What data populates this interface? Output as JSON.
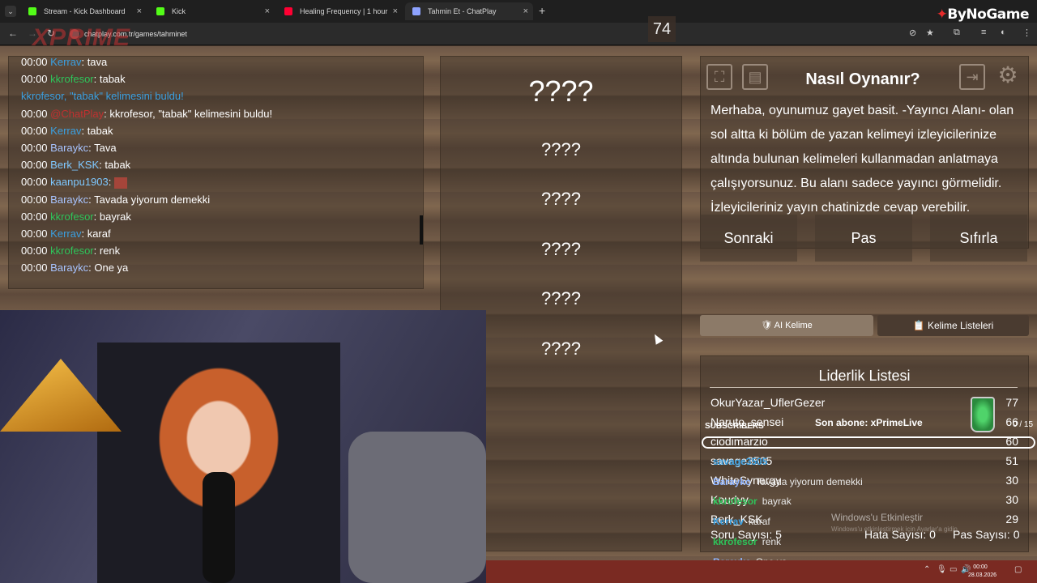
{
  "browser": {
    "tabs": [
      {
        "label": "Stream - Kick Dashboard",
        "icon_color": "#53fc18"
      },
      {
        "label": "Kick",
        "icon_color": "#53fc18"
      },
      {
        "label": "Healing Frequency | 1 hour",
        "icon_color": "#ff0033"
      },
      {
        "label": "Tahmin Et - ChatPlay",
        "icon_color": "#8ea3ff"
      }
    ],
    "url": "chatplay.com.tr/games/tahminet",
    "brand_prefix": "ByNo",
    "brand_suffix": "Game"
  },
  "overlay": {
    "xprime_logo": "XPRIME",
    "subscribers_label": "SUBSCRIBERS",
    "last_sub": "Son abone: xPrimeLive",
    "sub_progress": "0 / 15",
    "windows_watermark": "Windows'u Etkinleştir",
    "windows_watermark_sub": "Windows'u etkinleştirmek için Ayarlar'a gidin.",
    "clock_time": "00:00",
    "clock_date": "28.03.2026",
    "chat": [
      {
        "user": "savage3505",
        "msg": "",
        "color": "#3a9fe0"
      },
      {
        "user": "Baraykc",
        "msg": "Tavada yiyorum demekki",
        "color": "#8fb4ff"
      },
      {
        "user": "kkrofesor",
        "msg": "bayrak",
        "color": "#2ec45a"
      },
      {
        "user": "Kerrav",
        "msg": "karaf",
        "color": "#3a9fe0"
      },
      {
        "user": "kkrofesor",
        "msg": "renk",
        "color": "#2ec45a"
      },
      {
        "user": "Baraykc",
        "msg": "One ya",
        "color": "#8fb4ff"
      }
    ]
  },
  "chat": {
    "lines": [
      {
        "time": "00:00",
        "user": "Kerrav",
        "msg": ": tava",
        "color": "#3a9fe0"
      },
      {
        "time": "00:00",
        "user": "kkrofesor",
        "msg": ": tabak",
        "color": "#2ec45a"
      },
      {
        "time": "",
        "user": "kkrofesor, \"tabak\" kelimesini buldu!",
        "msg": "",
        "color": "#3a9fe0"
      },
      {
        "time": "00:00",
        "user": "@ChatPlay",
        "msg": ": kkrofesor, \"tabak\" kelimesini buldu!",
        "color": "#c03030"
      },
      {
        "time": "00:00",
        "user": "Kerrav",
        "msg": ": tabak",
        "color": "#3a9fe0"
      },
      {
        "time": "00:00",
        "user": "Baraykc",
        "msg": ": Tava",
        "color": "#a8c4ff"
      },
      {
        "time": "00:00",
        "user": "Berk_KSK",
        "msg": ": tabak",
        "color": "#7ec8ff"
      },
      {
        "time": "00:00",
        "user": "kaanpu1903",
        "msg": ":",
        "color": "#7ec8ff"
      },
      {
        "time": "00:00",
        "user": "Baraykc",
        "msg": ": Tavada yiyorum demekki",
        "color": "#a8c4ff"
      },
      {
        "time": "00:00",
        "user": "kkrofesor",
        "msg": ": bayrak",
        "color": "#2ec45a"
      },
      {
        "time": "00:00",
        "user": "Kerrav",
        "msg": ": karaf",
        "color": "#3a9fe0"
      },
      {
        "time": "00:00",
        "user": "kkrofesor",
        "msg": ": renk",
        "color": "#2ec45a"
      },
      {
        "time": "00:00",
        "user": "Baraykc",
        "msg": ": One ya",
        "color": "#a8c4ff"
      }
    ]
  },
  "game": {
    "counter": "74",
    "main_word": "????",
    "hidden_words": [
      "????",
      "????",
      "????",
      "????",
      "????"
    ],
    "howto_title": "Nasıl Oynanır?",
    "howto_text": "Merhaba, oyunumuz gayet basit. -Yayıncı Alanı- olan sol altta ki bölüm de yazan kelimeyi izleyicilerinize altında bulunan kelimeleri kullanmadan anlatmaya çalışıyorsunuz. Bu alanı sadece yayıncı görmelidir. İzleyicileriniz yayın chatinizde cevap verebilir.",
    "btn_next": "Sonraki",
    "btn_pass": "Pas",
    "btn_reset": "Sıfırla",
    "btn_ai": "AI Kelime",
    "btn_lists": "Kelime Listeleri",
    "leader_title": "Liderlik Listesi",
    "leaders": [
      {
        "name": "OkurYazar_UflerGezer",
        "score": "77"
      },
      {
        "name": "Naruto_sensei",
        "score": "66"
      },
      {
        "name": "ciodimarzio",
        "score": "60"
      },
      {
        "name": "savage3505",
        "score": "51"
      },
      {
        "name": "WhiteSynergy",
        "score": "30"
      },
      {
        "name": "Koudyy",
        "score": "30"
      },
      {
        "name": "Berk_KSK",
        "score": "29"
      }
    ],
    "soru": "Soru Sayısı: 5",
    "hata": "Hata Sayısı: 0",
    "pas": "Pas Sayısı: 0"
  }
}
